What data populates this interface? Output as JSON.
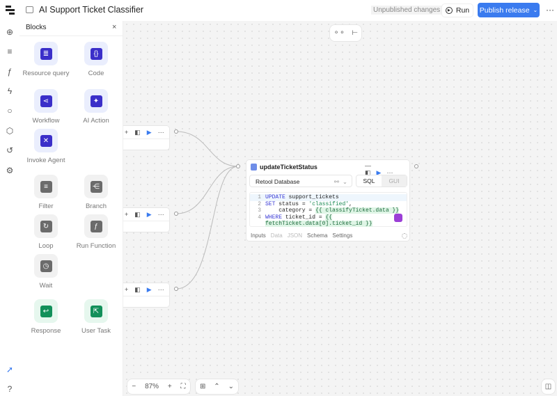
{
  "header": {
    "title": "AI Support Ticket Classifier",
    "status": "Unpublished changes",
    "run_label": "Run",
    "publish_label": "Publish release",
    "accent": "#3a7bef"
  },
  "rail": {
    "icons": [
      "plus-circle-icon",
      "list-icon",
      "function-icon",
      "bolt-icon",
      "search-icon",
      "cube-icon",
      "history-icon",
      "gear-icon",
      "rocket-icon",
      "help-icon"
    ]
  },
  "panel": {
    "title": "Blocks",
    "blocks": [
      {
        "label": "Resource query",
        "icon": "database-icon",
        "color": "#3b2fc9"
      },
      {
        "label": "Code",
        "icon": "braces-icon",
        "color": "#3b2fc9"
      },
      {
        "label": "Workflow",
        "icon": "share-icon",
        "color": "#3b2fc9"
      },
      {
        "label": "AI Action",
        "icon": "sparkle-icon",
        "color": "#3b2fc9"
      },
      {
        "label": "Invoke Agent",
        "icon": "agent-icon",
        "color": "#3b2fc9"
      },
      {
        "label": "Filter",
        "icon": "filter-icon",
        "color": "#6b6b6b"
      },
      {
        "label": "Branch",
        "icon": "branch-icon",
        "color": "#6b6b6b"
      },
      {
        "label": "Loop",
        "icon": "loop-icon",
        "color": "#6b6b6b"
      },
      {
        "label": "Run Function",
        "icon": "function-icon",
        "color": "#6b6b6b"
      },
      {
        "label": "Wait",
        "icon": "clock-icon",
        "color": "#6b6b6b"
      },
      {
        "label": "Response",
        "icon": "return-icon",
        "color": "#12905a"
      },
      {
        "label": "User Task",
        "icon": "user-task-icon",
        "color": "#12905a"
      }
    ]
  },
  "node": {
    "title": "updateTicketStatus",
    "resource": "Retool Database",
    "mode_sql": "SQL",
    "mode_gui": "GUI",
    "code": [
      {
        "n": "1",
        "parts": [
          [
            "kw",
            "UPDATE"
          ],
          [
            "",
            "support_tickets"
          ]
        ]
      },
      {
        "n": "2",
        "parts": [
          [
            "kw",
            "SET"
          ],
          [
            "",
            "status = "
          ],
          [
            "str",
            "'classified'"
          ],
          [
            "",
            ","
          ]
        ]
      },
      {
        "n": "3",
        "parts": [
          [
            "",
            "    category = "
          ],
          [
            "tpl",
            "{{ classifyTicket.data }}"
          ]
        ]
      },
      {
        "n": "4",
        "parts": [
          [
            "kw",
            "WHERE"
          ],
          [
            "",
            "ticket_id = "
          ],
          [
            "tpl",
            "{{"
          ]
        ]
      },
      {
        "n": "",
        "parts": [
          [
            "tpl",
            "fetchTicket.data[0].ticket_id }}"
          ]
        ]
      }
    ],
    "tabs": [
      "Inputs",
      "Data",
      "JSON",
      "Schema",
      "Settings"
    ]
  },
  "zoom": {
    "level": "87%"
  }
}
